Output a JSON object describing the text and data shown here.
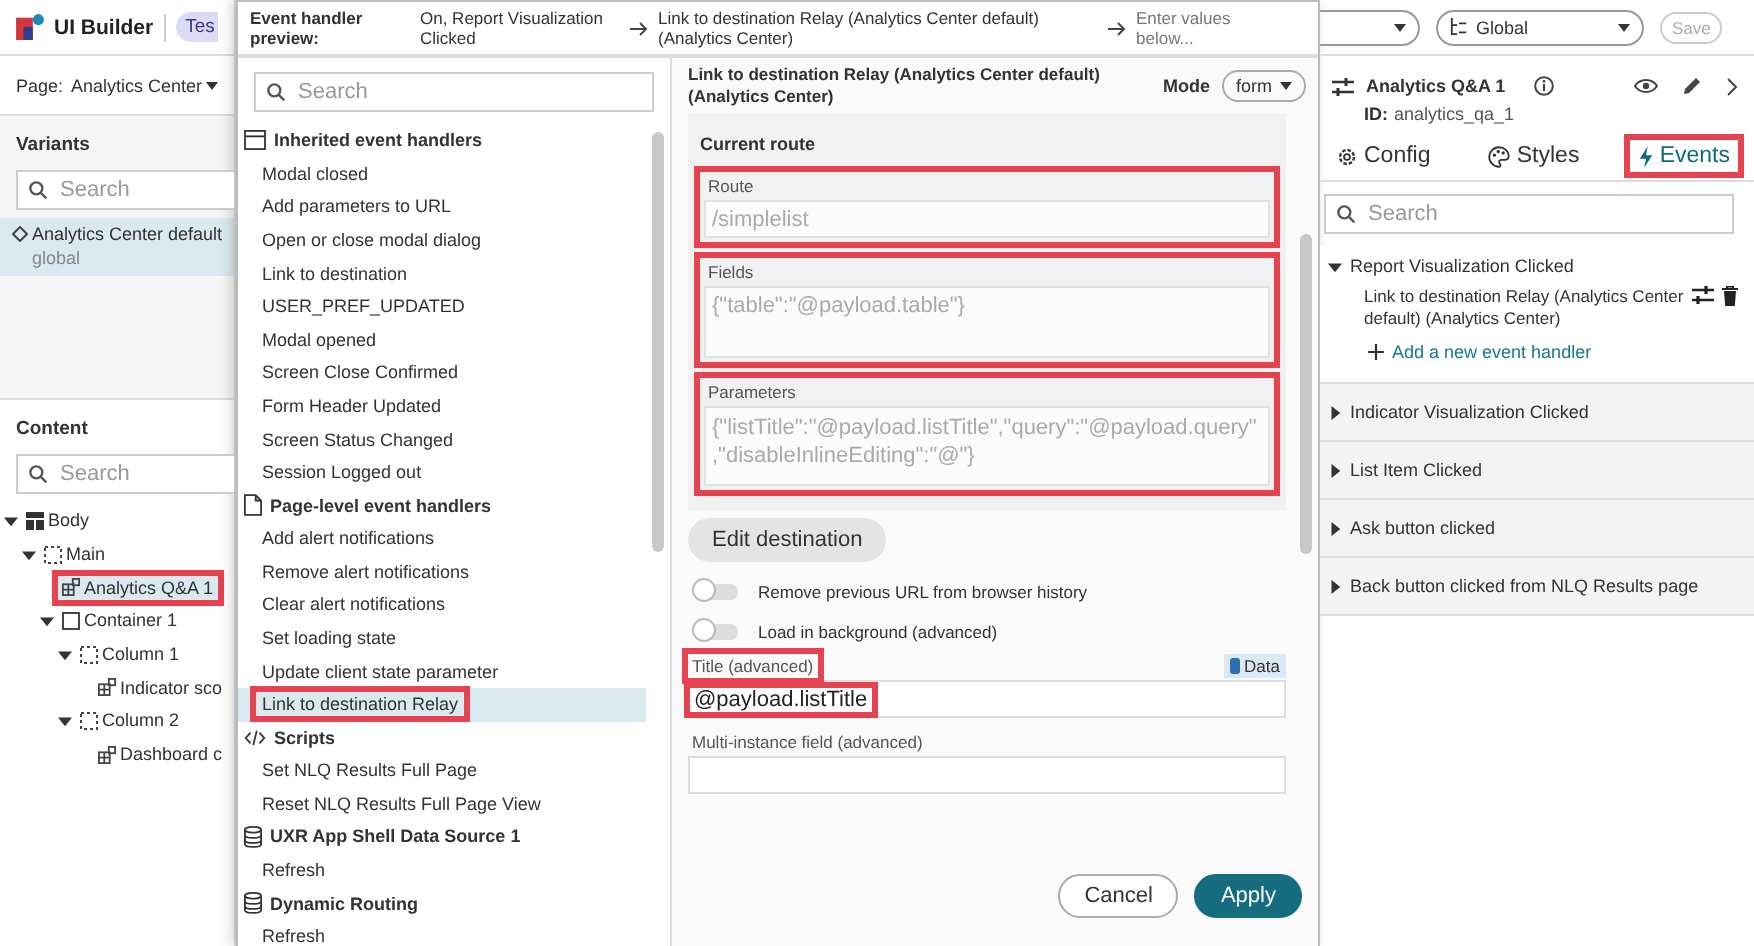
{
  "app": {
    "title": "UI Builder",
    "badge": "Tes"
  },
  "page_selector": {
    "label": "Page:",
    "value": "Analytics Center"
  },
  "variants": {
    "title": "Variants",
    "search_placeholder": "Search",
    "items": [
      {
        "name": "Analytics Center default",
        "scope": "global",
        "selected": true
      }
    ]
  },
  "content": {
    "title": "Content",
    "search_placeholder": "Search",
    "tree": [
      {
        "label": "Body",
        "kind": "layout",
        "expanded": true,
        "selected": false,
        "highlighted": false,
        "children": [
          {
            "label": "Main",
            "kind": "region",
            "expanded": true,
            "selected": false,
            "highlighted": false,
            "children": [
              {
                "label": "Analytics Q&A 1",
                "kind": "component",
                "selected": true,
                "highlighted": true
              },
              {
                "label": "Container 1",
                "kind": "container",
                "expanded": true,
                "selected": false,
                "highlighted": false,
                "children": [
                  {
                    "label": "Column 1",
                    "kind": "region",
                    "expanded": true,
                    "selected": false,
                    "highlighted": false,
                    "children": [
                      {
                        "label": "Indicator sco",
                        "kind": "component",
                        "selected": false,
                        "highlighted": false
                      }
                    ]
                  },
                  {
                    "label": "Column 2",
                    "kind": "region",
                    "expanded": true,
                    "selected": false,
                    "highlighted": false,
                    "children": [
                      {
                        "label": "Dashboard c",
                        "kind": "component",
                        "selected": false,
                        "highlighted": false
                      }
                    ]
                  }
                ]
              }
            ]
          }
        ]
      }
    ]
  },
  "event_preview": {
    "label": "Event handler preview:",
    "steps": [
      "On, Report Visualization Clicked",
      "Link to destination Relay (Analytics Center default) (Analytics Center)",
      "Enter values below..."
    ]
  },
  "handler_picker": {
    "search_placeholder": "Search",
    "groups": [
      {
        "title": "Inherited event handlers",
        "kind": "inherited",
        "items": [
          {
            "label": "Modal closed",
            "selected": false,
            "highlighted": false
          },
          {
            "label": "Add parameters to URL",
            "selected": false,
            "highlighted": false
          },
          {
            "label": "Open or close modal dialog",
            "selected": false,
            "highlighted": false
          },
          {
            "label": "Link to destination",
            "selected": false,
            "highlighted": false
          },
          {
            "label": "USER_PREF_UPDATED",
            "selected": false,
            "highlighted": false
          },
          {
            "label": "Modal opened",
            "selected": false,
            "highlighted": false
          },
          {
            "label": "Screen Close Confirmed",
            "selected": false,
            "highlighted": false
          },
          {
            "label": "Form Header Updated",
            "selected": false,
            "highlighted": false
          },
          {
            "label": "Screen Status Changed",
            "selected": false,
            "highlighted": false
          },
          {
            "label": "Session Logged out",
            "selected": false,
            "highlighted": false
          }
        ]
      },
      {
        "title": "Page-level event handlers",
        "kind": "page",
        "items": [
          {
            "label": "Add alert notifications",
            "selected": false,
            "highlighted": false
          },
          {
            "label": "Remove alert notifications",
            "selected": false,
            "highlighted": false
          },
          {
            "label": "Clear alert notifications",
            "selected": false,
            "highlighted": false
          },
          {
            "label": "Set loading state",
            "selected": false,
            "highlighted": false
          },
          {
            "label": "Update client state parameter",
            "selected": false,
            "highlighted": false
          },
          {
            "label": "Link to destination Relay",
            "selected": true,
            "highlighted": true
          }
        ]
      },
      {
        "title": "Scripts",
        "kind": "script",
        "items": [
          {
            "label": "Set NLQ Results Full Page",
            "selected": false,
            "highlighted": false
          },
          {
            "label": "Reset NLQ Results Full Page View",
            "selected": false,
            "highlighted": false
          }
        ]
      },
      {
        "title": "UXR App Shell Data Source 1",
        "kind": "datasource",
        "items": [
          {
            "label": "Refresh",
            "selected": false,
            "highlighted": false
          }
        ]
      },
      {
        "title": "Dynamic Routing",
        "kind": "datasource",
        "items": [
          {
            "label": "Refresh",
            "selected": false,
            "highlighted": false
          }
        ]
      }
    ]
  },
  "form": {
    "title": "Link to destination Relay (Analytics Center default) (Analytics Center)",
    "mode_label": "Mode",
    "mode": "form",
    "section_title": "Current route",
    "route_fields": [
      {
        "label": "Route",
        "placeholder": "/simplelist",
        "kind": "input",
        "highlighted": true
      },
      {
        "label": "Fields",
        "placeholder": "{\"table\":\"@payload.table\"}",
        "kind": "textarea",
        "highlighted": true
      },
      {
        "label": "Parameters",
        "placeholder": "{\"listTitle\":\"@payload.listTitle\",\"query\":\"@payload.query\",\"disableInlineEditing\":\"@\"}",
        "kind": "textarea",
        "highlighted": true
      }
    ],
    "edit_button": "Edit destination",
    "toggles": [
      {
        "label": "Remove previous URL from browser history",
        "on": false
      },
      {
        "label": "Load in background (advanced)",
        "on": false
      }
    ],
    "advanced_fields": [
      {
        "label": "Title (advanced)",
        "value": "@payload.listTitle",
        "badge": "Data",
        "highlighted": true
      },
      {
        "label": "Multi-instance field (advanced)",
        "highlighted": false
      }
    ],
    "buttons": [
      {
        "label": "Cancel",
        "kind": "secondary"
      },
      {
        "label": "Apply",
        "kind": "primary"
      }
    ]
  },
  "toolbar": {
    "scope": "Global",
    "save": {
      "label": "Save",
      "disabled": true
    }
  },
  "inspector": {
    "title": "Analytics Q&A 1",
    "id_label": "ID:",
    "id": "analytics_qa_1",
    "tabs": [
      {
        "label": "Config",
        "kind": "config",
        "selected": false,
        "highlighted": false
      },
      {
        "label": "Styles",
        "kind": "styles",
        "selected": false,
        "highlighted": false
      },
      {
        "label": "Events",
        "kind": "events",
        "selected": true,
        "highlighted": true
      }
    ],
    "search_placeholder": "Search",
    "events": [
      {
        "name": "Report Visualization Clicked",
        "expanded": true,
        "handlers": [
          "Link to destination Relay (Analytics Center default) (Analytics Center)"
        ],
        "add_label": "Add a new event handler"
      },
      {
        "name": "Indicator Visualization Clicked",
        "expanded": false
      },
      {
        "name": "List Item Clicked",
        "expanded": false
      },
      {
        "name": "Ask button clicked",
        "expanded": false
      },
      {
        "name": "Back button clicked from NLQ Results page",
        "expanded": false
      }
    ]
  }
}
